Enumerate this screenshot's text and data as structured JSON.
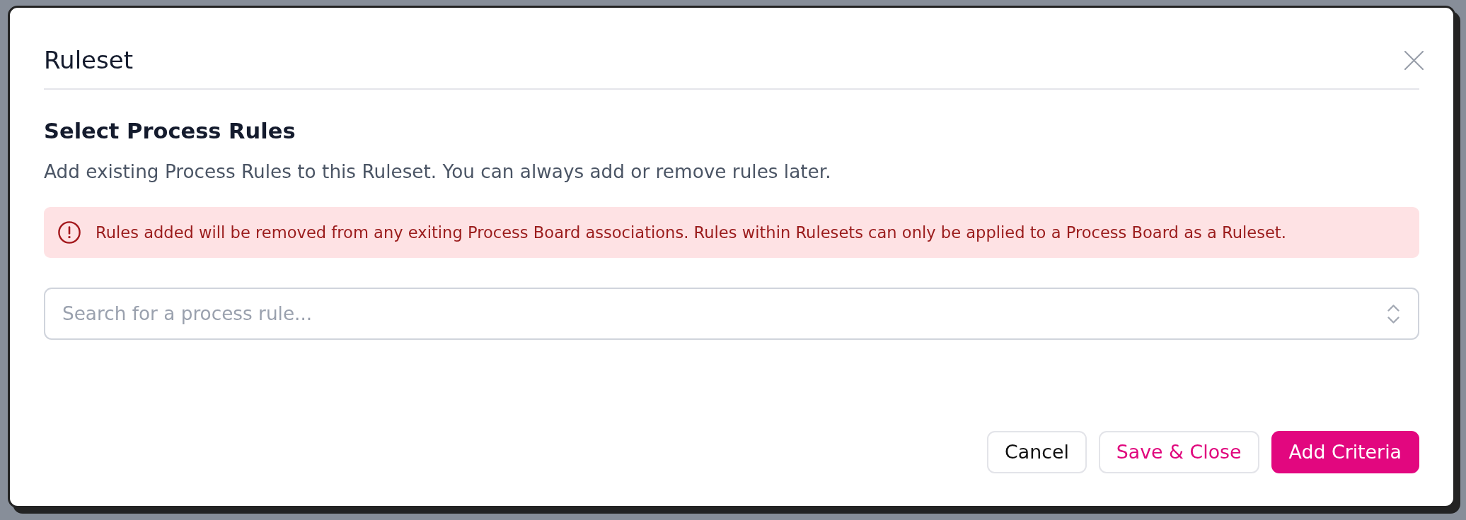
{
  "modal": {
    "title": "Ruleset"
  },
  "section": {
    "heading": "Select Process Rules",
    "description": "Add existing Process Rules to this Ruleset. You can always add or remove rules later."
  },
  "alert": {
    "kind": "danger",
    "message": "Rules added will be removed from any exiting Process Board associations. Rules within Rulesets can only be applied to a Process Board as a Ruleset."
  },
  "search": {
    "placeholder": "Search for a process rule..."
  },
  "buttons": [
    {
      "label": "Cancel",
      "kind": "secondary"
    },
    {
      "label": "Save & Close",
      "kind": "outline"
    },
    {
      "label": "Add Criteria",
      "kind": "primary"
    }
  ]
}
